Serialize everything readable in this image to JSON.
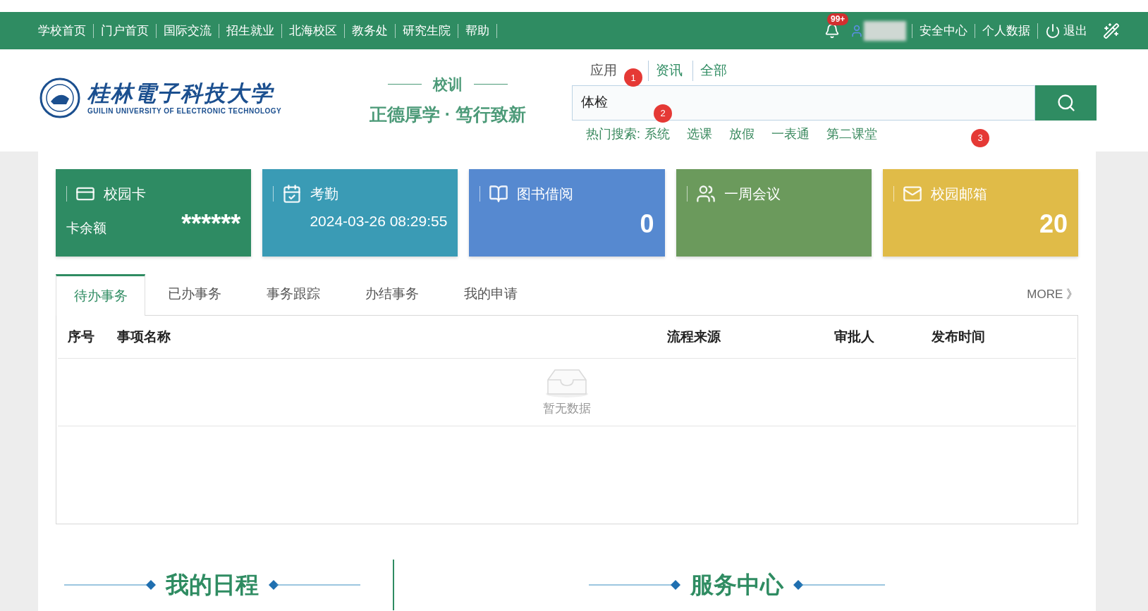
{
  "top_nav": {
    "links": [
      "学校首页",
      "门户首页",
      "国际交流",
      "招生就业",
      "北海校区",
      "教务处",
      "研究生院",
      "帮助"
    ],
    "notification_badge": "99+",
    "user_links": [
      "安全中心",
      "个人数据",
      "退出"
    ]
  },
  "header": {
    "logo_name": "桂林電子科技大学",
    "logo_subtitle": "GUILIN UNIVERSITY OF ELECTRONIC TECHNOLOGY",
    "motto_title": "校训",
    "motto": "正德厚学 · 笃行致新",
    "search_tabs": [
      {
        "label": "应用",
        "selected": true
      },
      {
        "label": "资讯",
        "selected": false
      },
      {
        "label": "全部",
        "selected": false
      }
    ],
    "search_value": "体检",
    "hot_label": "热门搜索:",
    "hot_terms": [
      "系统",
      "选课",
      "放假",
      "一表通",
      "第二课堂"
    ],
    "annotations": [
      "1",
      "2",
      "3"
    ]
  },
  "cards": [
    {
      "kind": "card",
      "title": "校园卡",
      "label": "卡余额",
      "value": "******",
      "color": "#2e8b63"
    },
    {
      "kind": "calendar",
      "title": "考勤",
      "value": "2024-03-26 08:29:55",
      "color": "#3a9bb5"
    },
    {
      "kind": "book",
      "title": "图书借阅",
      "value": "0",
      "color": "#5689d0"
    },
    {
      "kind": "people",
      "title": "一周会议",
      "color": "#6b9a5c"
    },
    {
      "kind": "mail",
      "title": "校园邮箱",
      "value": "20",
      "color": "#e0bb48"
    }
  ],
  "tabs": [
    {
      "label": "待办事务",
      "selected": true
    },
    {
      "label": "已办事务",
      "selected": false
    },
    {
      "label": "事务跟踪",
      "selected": false
    },
    {
      "label": "办结事务",
      "selected": false
    },
    {
      "label": "我的申请",
      "selected": false
    }
  ],
  "more": "MORE 》",
  "table": {
    "columns": [
      "序号",
      "事项名称",
      "流程来源",
      "审批人",
      "发布时间"
    ],
    "empty_text": "暂无数据"
  },
  "sections": [
    "我的日程",
    "服务中心"
  ]
}
